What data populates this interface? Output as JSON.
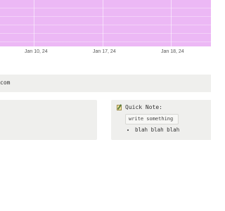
{
  "chart": {
    "fill_color": "#ecb8f5",
    "tick_labels": [
      "Jan 10, 24",
      "Jan 17, 24",
      "Jan 18, 24"
    ]
  },
  "url_bar": {
    "text": "com"
  },
  "quick_note": {
    "title": "Quick Note:",
    "icon": "note-icon",
    "input_placeholder": "write something",
    "items": [
      "blah blah blah"
    ]
  }
}
